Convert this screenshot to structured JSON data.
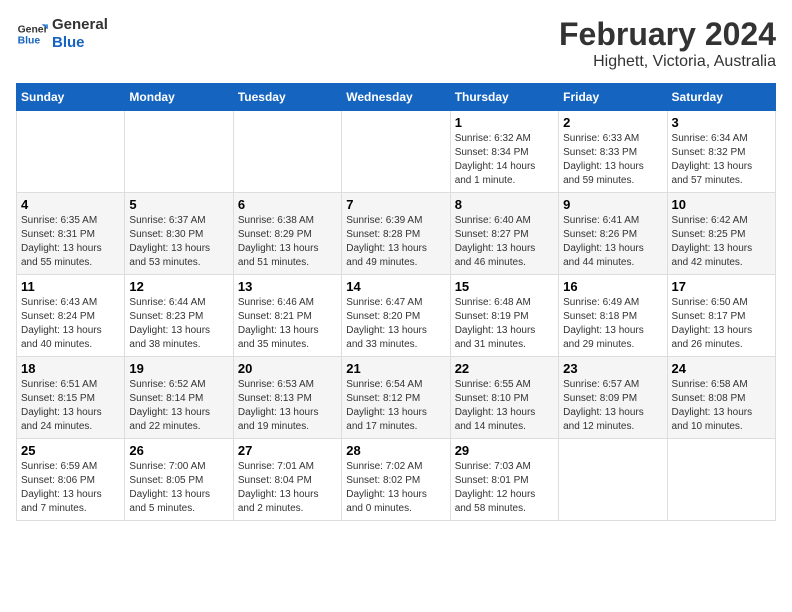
{
  "logo": {
    "line1": "General",
    "line2": "Blue"
  },
  "title": "February 2024",
  "subtitle": "Highett, Victoria, Australia",
  "days_of_week": [
    "Sunday",
    "Monday",
    "Tuesday",
    "Wednesday",
    "Thursday",
    "Friday",
    "Saturday"
  ],
  "weeks": [
    [
      {
        "num": "",
        "info": ""
      },
      {
        "num": "",
        "info": ""
      },
      {
        "num": "",
        "info": ""
      },
      {
        "num": "",
        "info": ""
      },
      {
        "num": "1",
        "info": "Sunrise: 6:32 AM\nSunset: 8:34 PM\nDaylight: 14 hours\nand 1 minute."
      },
      {
        "num": "2",
        "info": "Sunrise: 6:33 AM\nSunset: 8:33 PM\nDaylight: 13 hours\nand 59 minutes."
      },
      {
        "num": "3",
        "info": "Sunrise: 6:34 AM\nSunset: 8:32 PM\nDaylight: 13 hours\nand 57 minutes."
      }
    ],
    [
      {
        "num": "4",
        "info": "Sunrise: 6:35 AM\nSunset: 8:31 PM\nDaylight: 13 hours\nand 55 minutes."
      },
      {
        "num": "5",
        "info": "Sunrise: 6:37 AM\nSunset: 8:30 PM\nDaylight: 13 hours\nand 53 minutes."
      },
      {
        "num": "6",
        "info": "Sunrise: 6:38 AM\nSunset: 8:29 PM\nDaylight: 13 hours\nand 51 minutes."
      },
      {
        "num": "7",
        "info": "Sunrise: 6:39 AM\nSunset: 8:28 PM\nDaylight: 13 hours\nand 49 minutes."
      },
      {
        "num": "8",
        "info": "Sunrise: 6:40 AM\nSunset: 8:27 PM\nDaylight: 13 hours\nand 46 minutes."
      },
      {
        "num": "9",
        "info": "Sunrise: 6:41 AM\nSunset: 8:26 PM\nDaylight: 13 hours\nand 44 minutes."
      },
      {
        "num": "10",
        "info": "Sunrise: 6:42 AM\nSunset: 8:25 PM\nDaylight: 13 hours\nand 42 minutes."
      }
    ],
    [
      {
        "num": "11",
        "info": "Sunrise: 6:43 AM\nSunset: 8:24 PM\nDaylight: 13 hours\nand 40 minutes."
      },
      {
        "num": "12",
        "info": "Sunrise: 6:44 AM\nSunset: 8:23 PM\nDaylight: 13 hours\nand 38 minutes."
      },
      {
        "num": "13",
        "info": "Sunrise: 6:46 AM\nSunset: 8:21 PM\nDaylight: 13 hours\nand 35 minutes."
      },
      {
        "num": "14",
        "info": "Sunrise: 6:47 AM\nSunset: 8:20 PM\nDaylight: 13 hours\nand 33 minutes."
      },
      {
        "num": "15",
        "info": "Sunrise: 6:48 AM\nSunset: 8:19 PM\nDaylight: 13 hours\nand 31 minutes."
      },
      {
        "num": "16",
        "info": "Sunrise: 6:49 AM\nSunset: 8:18 PM\nDaylight: 13 hours\nand 29 minutes."
      },
      {
        "num": "17",
        "info": "Sunrise: 6:50 AM\nSunset: 8:17 PM\nDaylight: 13 hours\nand 26 minutes."
      }
    ],
    [
      {
        "num": "18",
        "info": "Sunrise: 6:51 AM\nSunset: 8:15 PM\nDaylight: 13 hours\nand 24 minutes."
      },
      {
        "num": "19",
        "info": "Sunrise: 6:52 AM\nSunset: 8:14 PM\nDaylight: 13 hours\nand 22 minutes."
      },
      {
        "num": "20",
        "info": "Sunrise: 6:53 AM\nSunset: 8:13 PM\nDaylight: 13 hours\nand 19 minutes."
      },
      {
        "num": "21",
        "info": "Sunrise: 6:54 AM\nSunset: 8:12 PM\nDaylight: 13 hours\nand 17 minutes."
      },
      {
        "num": "22",
        "info": "Sunrise: 6:55 AM\nSunset: 8:10 PM\nDaylight: 13 hours\nand 14 minutes."
      },
      {
        "num": "23",
        "info": "Sunrise: 6:57 AM\nSunset: 8:09 PM\nDaylight: 13 hours\nand 12 minutes."
      },
      {
        "num": "24",
        "info": "Sunrise: 6:58 AM\nSunset: 8:08 PM\nDaylight: 13 hours\nand 10 minutes."
      }
    ],
    [
      {
        "num": "25",
        "info": "Sunrise: 6:59 AM\nSunset: 8:06 PM\nDaylight: 13 hours\nand 7 minutes."
      },
      {
        "num": "26",
        "info": "Sunrise: 7:00 AM\nSunset: 8:05 PM\nDaylight: 13 hours\nand 5 minutes."
      },
      {
        "num": "27",
        "info": "Sunrise: 7:01 AM\nSunset: 8:04 PM\nDaylight: 13 hours\nand 2 minutes."
      },
      {
        "num": "28",
        "info": "Sunrise: 7:02 AM\nSunset: 8:02 PM\nDaylight: 13 hours\nand 0 minutes."
      },
      {
        "num": "29",
        "info": "Sunrise: 7:03 AM\nSunset: 8:01 PM\nDaylight: 12 hours\nand 58 minutes."
      },
      {
        "num": "",
        "info": ""
      },
      {
        "num": "",
        "info": ""
      }
    ]
  ]
}
